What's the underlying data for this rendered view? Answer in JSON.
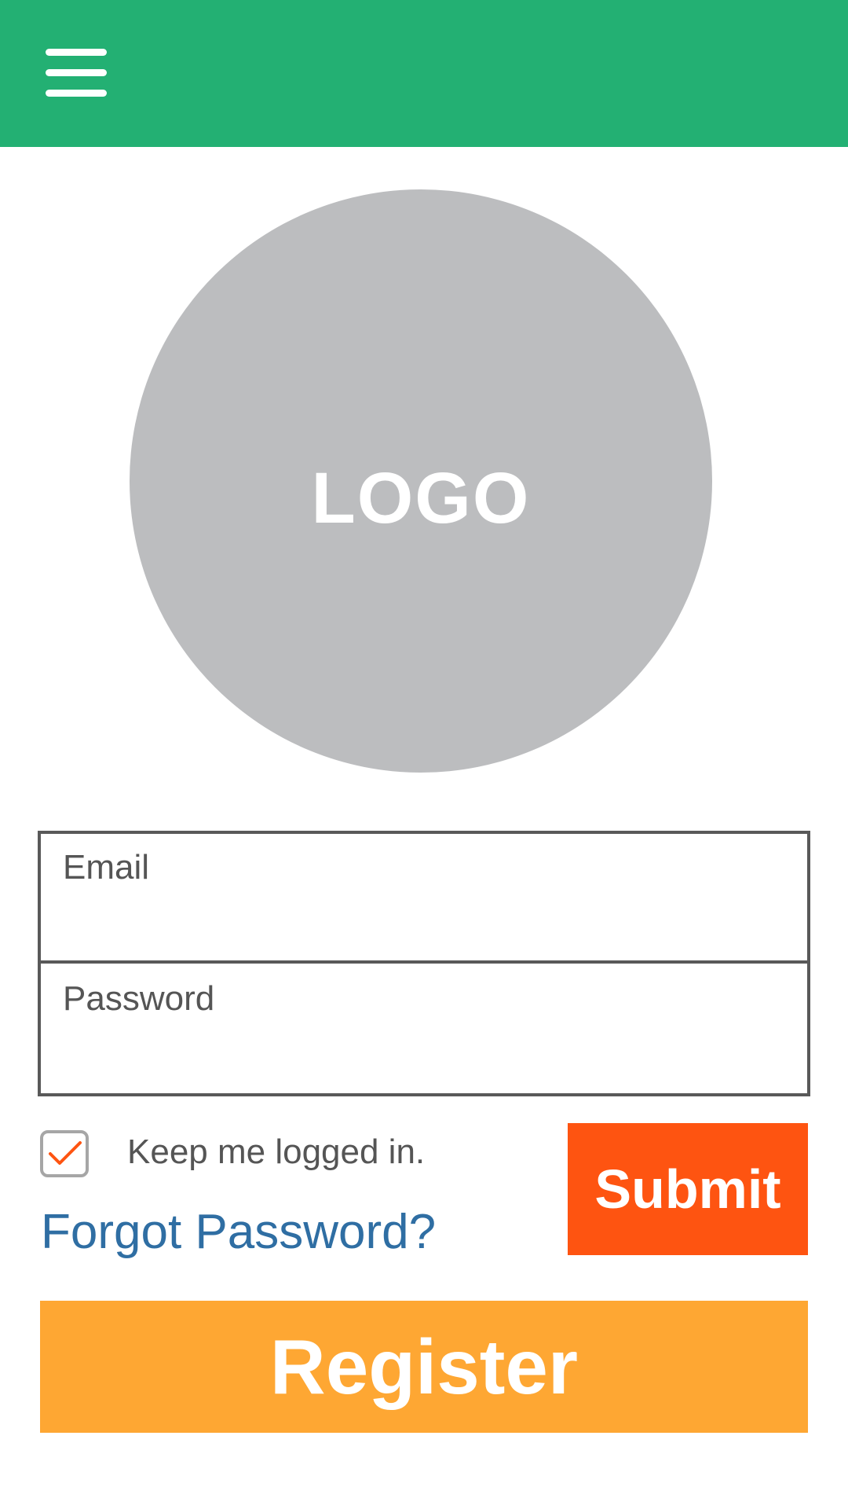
{
  "colors": {
    "header": "#23b073",
    "logo_circle": "#bcbdbf",
    "submit": "#fe5411",
    "register": "#fea733",
    "link": "#2f6ea3",
    "checkmark": "#fe5411"
  },
  "header": {
    "menu_icon": "hamburger-menu-icon"
  },
  "logo": {
    "text": "LOGO"
  },
  "form": {
    "email_label": "Email",
    "password_label": "Password"
  },
  "options": {
    "keep_logged_in_label": "Keep me logged in.",
    "keep_logged_in_checked": true,
    "checkbox_icon": "checkmark-icon",
    "forgot_password": "Forgot Password?"
  },
  "actions": {
    "submit_label": "Submit",
    "register_label": "Register"
  }
}
